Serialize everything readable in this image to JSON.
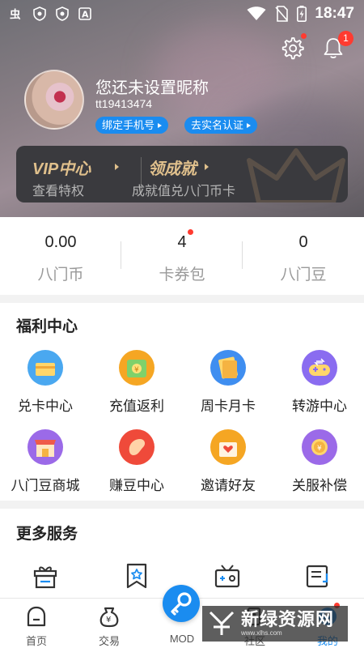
{
  "status_bar": {
    "time": "18:47",
    "left_icons": [
      "app-logo-icon",
      "shield-icon",
      "shield-icon",
      "font-icon"
    ],
    "right_icons": [
      "wifi-icon",
      "no-sim-icon",
      "battery-charging-icon"
    ]
  },
  "header": {
    "settings_icon": "gear-icon",
    "settings_has_dot": true,
    "notification_icon": "bell-icon",
    "notification_count": "1"
  },
  "profile": {
    "nickname": "您还未设置昵称",
    "user_id": "tt19413474",
    "bind_phone_label": "绑定手机号",
    "verify_label": "去实名认证"
  },
  "vip": {
    "left_title": "VIP中心",
    "left_sub": "查看特权",
    "right_title": "领成就",
    "right_sub": "成就值兑八门币卡"
  },
  "stats": [
    {
      "value": "0.00",
      "label": "八门币",
      "has_dot": false
    },
    {
      "value": "4",
      "label": "卡券包",
      "has_dot": true
    },
    {
      "value": "0",
      "label": "八门豆",
      "has_dot": false
    }
  ],
  "welfare": {
    "title": "福利中心",
    "items": [
      {
        "label": "兑卡中心",
        "icon": "card-exchange-icon",
        "color": "#4aa8f0"
      },
      {
        "label": "充值返利",
        "icon": "recharge-rebate-icon",
        "color": "#f5a623"
      },
      {
        "label": "周卡月卡",
        "icon": "weekly-card-icon",
        "color": "#3f8ef0"
      },
      {
        "label": "转游中心",
        "icon": "gamepad-transfer-icon",
        "color": "#8a6cf0"
      },
      {
        "label": "八门豆商城",
        "icon": "mall-icon",
        "color": "#9b6ae8"
      },
      {
        "label": "赚豆中心",
        "icon": "earn-beans-icon",
        "color": "#ef4a3a"
      },
      {
        "label": "邀请好友",
        "icon": "invite-friend-icon",
        "color": "#f5a623"
      },
      {
        "label": "关服补偿",
        "icon": "compensation-icon",
        "color": "#9b6ae8"
      }
    ]
  },
  "more_services": {
    "title": "更多服务",
    "icons": [
      "gift-box-icon",
      "star-bookmark-icon",
      "radio-icon",
      "document-icon"
    ]
  },
  "tabbar": {
    "tabs": [
      {
        "label": "首页",
        "icon": "home-icon"
      },
      {
        "label": "交易",
        "icon": "money-bag-icon"
      },
      {
        "label": "MOD",
        "icon": "key-icon"
      },
      {
        "label": "社区",
        "icon": "community-icon"
      },
      {
        "label": "我的",
        "icon": "profile-icon"
      }
    ],
    "active_color": "#1a8cf0"
  },
  "watermark": {
    "text": "新绿资源网",
    "url_text": "www.xlhs.com"
  }
}
